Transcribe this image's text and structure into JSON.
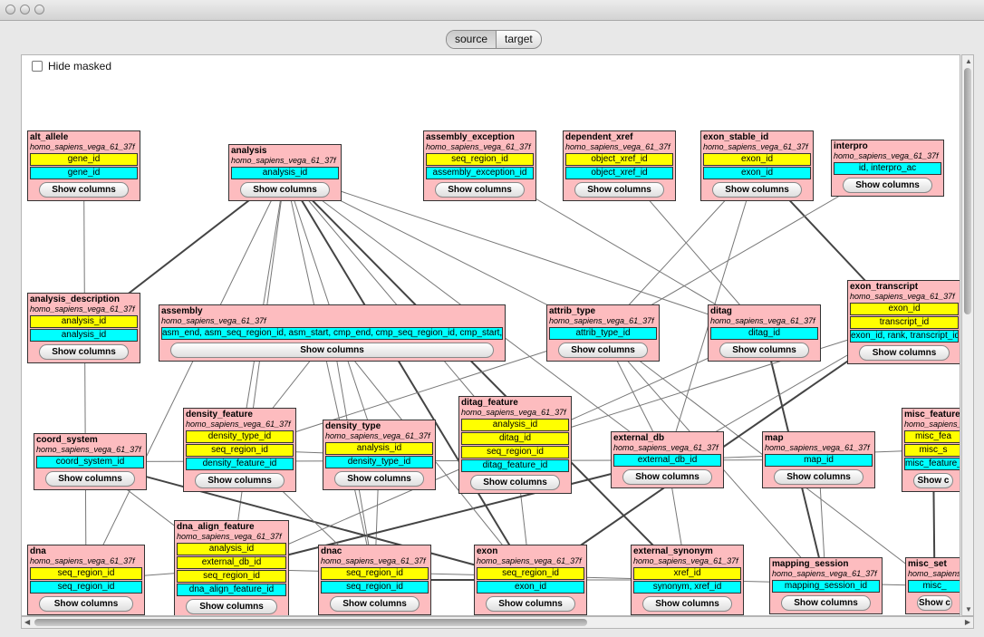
{
  "toolbar": {
    "tabs": [
      {
        "label": "source"
      },
      {
        "label": "target"
      }
    ],
    "hide_masked": "Hide masked"
  },
  "show_columns": "Show columns",
  "tables": [
    {
      "id": "alt_allele",
      "name": "alt_allele",
      "schema": "homo_sapiens_vega_61_37f",
      "keys": [
        {
          "t": "y",
          "v": "gene_id"
        },
        {
          "t": "c",
          "v": "gene_id"
        }
      ]
    },
    {
      "id": "analysis",
      "name": "analysis",
      "schema": "homo_sapiens_vega_61_37f",
      "keys": [
        {
          "t": "c",
          "v": "analysis_id"
        }
      ]
    },
    {
      "id": "assembly_exception",
      "name": "assembly_exception",
      "schema": "homo_sapiens_vega_61_37f",
      "keys": [
        {
          "t": "y",
          "v": "seq_region_id"
        },
        {
          "t": "c",
          "v": "assembly_exception_id"
        }
      ]
    },
    {
      "id": "dependent_xref",
      "name": "dependent_xref",
      "schema": "homo_sapiens_vega_61_37f",
      "keys": [
        {
          "t": "y",
          "v": "object_xref_id"
        },
        {
          "t": "c",
          "v": "object_xref_id"
        }
      ]
    },
    {
      "id": "exon_stable_id",
      "name": "exon_stable_id",
      "schema": "homo_sapiens_vega_61_37f",
      "keys": [
        {
          "t": "y",
          "v": "exon_id"
        },
        {
          "t": "c",
          "v": "exon_id"
        }
      ]
    },
    {
      "id": "interpro",
      "name": "interpro",
      "schema": "homo_sapiens_vega_61_37f",
      "keys": [
        {
          "t": "c",
          "v": "id, interpro_ac"
        }
      ]
    },
    {
      "id": "analysis_description",
      "name": "analysis_description",
      "schema": "homo_sapiens_vega_61_37f",
      "keys": [
        {
          "t": "y",
          "v": "analysis_id"
        },
        {
          "t": "c",
          "v": "analysis_id"
        }
      ]
    },
    {
      "id": "assembly",
      "name": "assembly",
      "schema": "homo_sapiens_vega_61_37f",
      "keys": [
        {
          "t": "c",
          "v": "asm_end, asm_seq_region_id, asm_start, cmp_end, cmp_seq_region_id, cmp_start, ori"
        }
      ]
    },
    {
      "id": "attrib_type",
      "name": "attrib_type",
      "schema": "homo_sapiens_vega_61_37f",
      "keys": [
        {
          "t": "c",
          "v": "attrib_type_id"
        }
      ]
    },
    {
      "id": "ditag",
      "name": "ditag",
      "schema": "homo_sapiens_vega_61_37f",
      "keys": [
        {
          "t": "c",
          "v": "ditag_id"
        }
      ]
    },
    {
      "id": "exon_transcript",
      "name": "exon_transcript",
      "schema": "homo_sapiens_vega_61_37f",
      "keys": [
        {
          "t": "y",
          "v": "exon_id"
        },
        {
          "t": "y",
          "v": "transcript_id"
        },
        {
          "t": "c",
          "v": "exon_id, rank, transcript_id"
        }
      ]
    },
    {
      "id": "coord_system",
      "name": "coord_system",
      "schema": "homo_sapiens_vega_61_37f",
      "keys": [
        {
          "t": "c",
          "v": "coord_system_id"
        }
      ]
    },
    {
      "id": "density_feature",
      "name": "density_feature",
      "schema": "homo_sapiens_vega_61_37f",
      "keys": [
        {
          "t": "y",
          "v": "density_type_id"
        },
        {
          "t": "y",
          "v": "seq_region_id"
        },
        {
          "t": "c",
          "v": "density_feature_id"
        }
      ]
    },
    {
      "id": "density_type",
      "name": "density_type",
      "schema": "homo_sapiens_vega_61_37f",
      "keys": [
        {
          "t": "y",
          "v": "analysis_id"
        },
        {
          "t": "c",
          "v": "density_type_id"
        }
      ]
    },
    {
      "id": "ditag_feature",
      "name": "ditag_feature",
      "schema": "homo_sapiens_vega_61_37f",
      "keys": [
        {
          "t": "y",
          "v": "analysis_id"
        },
        {
          "t": "y",
          "v": "ditag_id"
        },
        {
          "t": "y",
          "v": "seq_region_id"
        },
        {
          "t": "c",
          "v": "ditag_feature_id"
        }
      ]
    },
    {
      "id": "external_db",
      "name": "external_db",
      "schema": "homo_sapiens_vega_61_37f",
      "keys": [
        {
          "t": "c",
          "v": "external_db_id"
        }
      ]
    },
    {
      "id": "map",
      "name": "map",
      "schema": "homo_sapiens_vega_61_37f",
      "keys": [
        {
          "t": "c",
          "v": "map_id"
        }
      ]
    },
    {
      "id": "misc_feature",
      "name": "misc_feature_",
      "schema": "homo_sapiens_",
      "keys": [
        {
          "t": "y",
          "v": "misc_fea"
        },
        {
          "t": "y",
          "v": "misc_s"
        },
        {
          "t": "c",
          "v": "misc_feature_i"
        }
      ],
      "btn": "Show c"
    },
    {
      "id": "dna",
      "name": "dna",
      "schema": "homo_sapiens_vega_61_37f",
      "keys": [
        {
          "t": "y",
          "v": "seq_region_id"
        },
        {
          "t": "c",
          "v": "seq_region_id"
        }
      ]
    },
    {
      "id": "dna_align_feature",
      "name": "dna_align_feature",
      "schema": "homo_sapiens_vega_61_37f",
      "keys": [
        {
          "t": "y",
          "v": "analysis_id"
        },
        {
          "t": "y",
          "v": "external_db_id"
        },
        {
          "t": "y",
          "v": "seq_region_id"
        },
        {
          "t": "c",
          "v": "dna_align_feature_id"
        }
      ]
    },
    {
      "id": "dnac",
      "name": "dnac",
      "schema": "homo_sapiens_vega_61_37f",
      "keys": [
        {
          "t": "y",
          "v": "seq_region_id"
        },
        {
          "t": "c",
          "v": "seq_region_id"
        }
      ]
    },
    {
      "id": "exon",
      "name": "exon",
      "schema": "homo_sapiens_vega_61_37f",
      "keys": [
        {
          "t": "y",
          "v": "seq_region_id"
        },
        {
          "t": "c",
          "v": "exon_id"
        }
      ]
    },
    {
      "id": "external_synonym",
      "name": "external_synonym",
      "schema": "homo_sapiens_vega_61_37f",
      "keys": [
        {
          "t": "y",
          "v": "xref_id"
        },
        {
          "t": "c",
          "v": "synonym, xref_id"
        }
      ]
    },
    {
      "id": "mapping_session",
      "name": "mapping_session",
      "schema": "homo_sapiens_vega_61_37f",
      "keys": [
        {
          "t": "c",
          "v": "mapping_session_id"
        }
      ]
    },
    {
      "id": "misc_set",
      "name": "misc_set",
      "schema": "homo_sapiens",
      "keys": [
        {
          "t": "c",
          "v": "misc_"
        }
      ],
      "btn": "Show c"
    }
  ]
}
